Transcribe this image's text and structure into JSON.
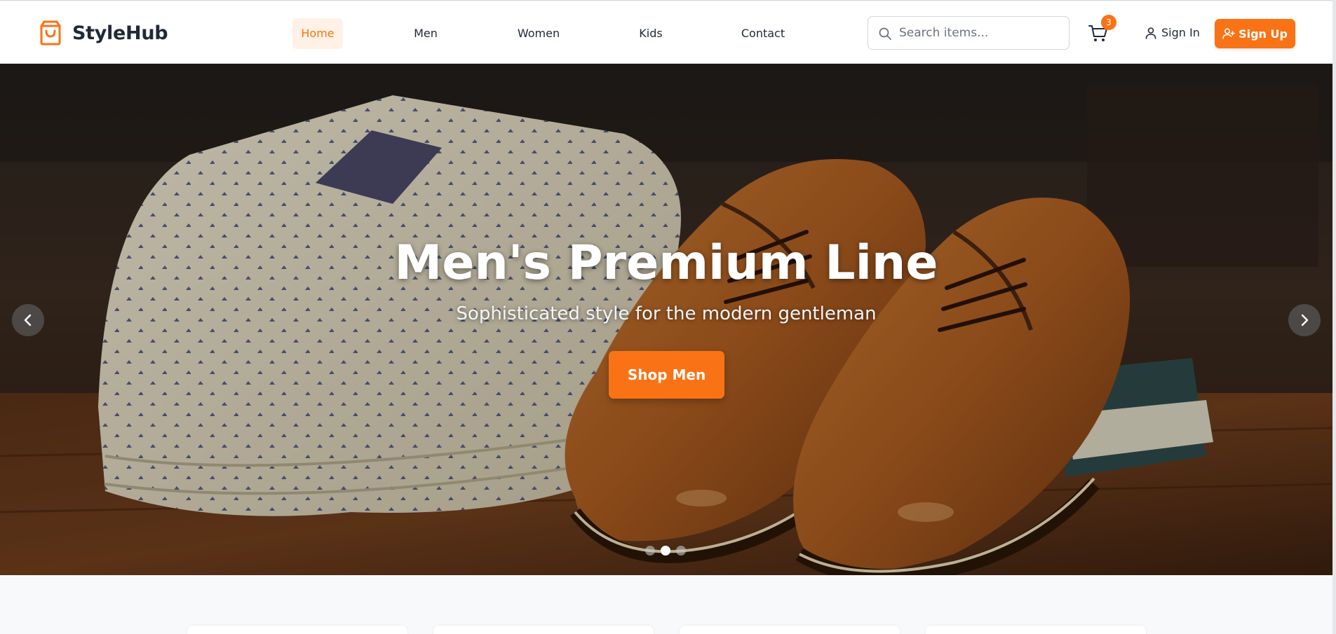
{
  "brand": {
    "name": "StyleHub",
    "accent_color": "#f97316",
    "logo_icon": "shopping-bag-icon"
  },
  "nav": {
    "items": [
      {
        "label": "Home",
        "active": true
      },
      {
        "label": "Men",
        "active": false
      },
      {
        "label": "Women",
        "active": false
      },
      {
        "label": "Kids",
        "active": false
      },
      {
        "label": "Contact",
        "active": false
      }
    ]
  },
  "search": {
    "placeholder": "Search items...",
    "value": "",
    "icon": "search-icon"
  },
  "cart": {
    "icon": "shopping-cart-icon",
    "count": "3"
  },
  "auth": {
    "sign_in_label": "Sign In",
    "sign_in_icon": "user-icon",
    "sign_up_label": "Sign Up",
    "sign_up_icon": "user-plus-icon"
  },
  "hero": {
    "title": "Men's Premium Line",
    "subtitle": "Sophisticated style for the modern gentleman",
    "cta_label": "Shop Men",
    "image_subject": "folded patterned shirts and brown leather oxford shoes",
    "prev_icon": "chevron-left-icon",
    "next_icon": "chevron-right-icon",
    "slide_count": 3,
    "active_slide": 2
  }
}
